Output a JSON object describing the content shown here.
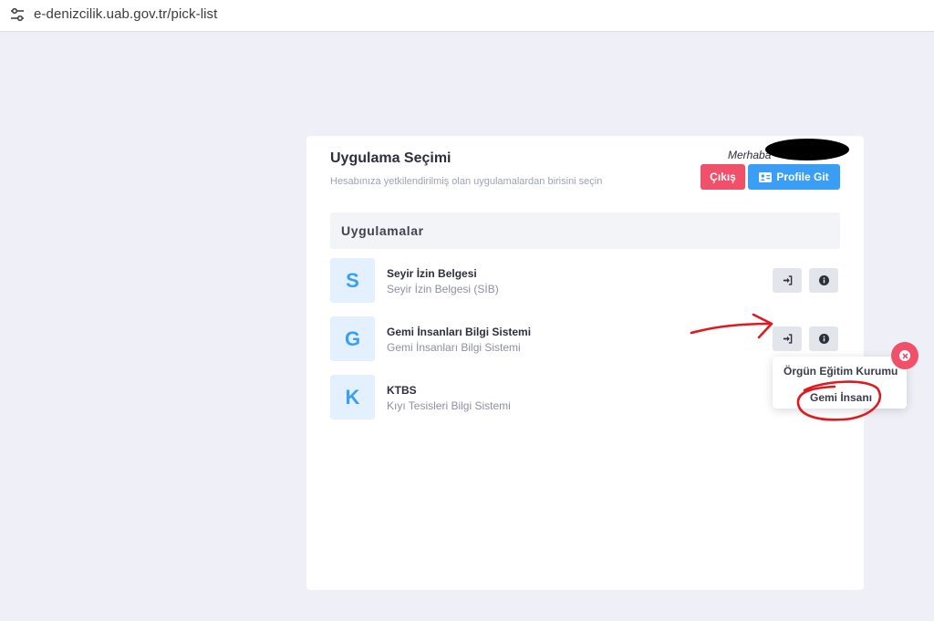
{
  "browser": {
    "url": "e-denizcilik.uab.gov.tr/pick-list",
    "site_info_icon": "tune-icon"
  },
  "page": {
    "title": "Uygulama Seçimi",
    "subtitle": "Hesabınıza yetkilendirilmiş olan uygulamalardan birisini seçin",
    "greeting": "Merhaba",
    "exit_button": "Çıkış",
    "profile_button": "Profile Git",
    "section_title": "Uygulamalar"
  },
  "apps": [
    {
      "letter": "S",
      "name": "Seyir İzin Belgesi",
      "description": "Seyir İzin Belgesi (SİB)"
    },
    {
      "letter": "G",
      "name": "Gemi İnsanları Bilgi Sistemi",
      "description": "Gemi İnsanları Bilgi Sistemi"
    },
    {
      "letter": "K",
      "name": "KTBS",
      "description": "Kıyı Tesisleri Bilgi Sistemi"
    }
  ],
  "dropdown": {
    "options": [
      "Örgün Eğitim Kurumu",
      "Gemi İnsanı"
    ]
  },
  "colors": {
    "background": "#eff0f7",
    "accent_blue": "#3a9ef5",
    "danger_red": "#f1506a",
    "annotation_red": "#e0191e"
  }
}
